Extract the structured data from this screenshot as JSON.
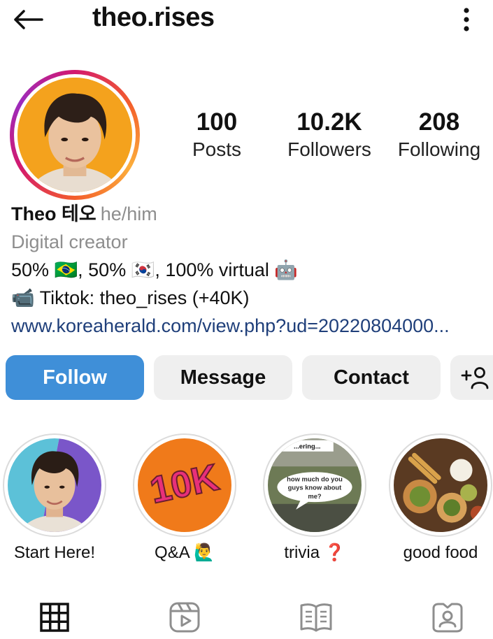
{
  "header": {
    "username": "theo.rises",
    "back_icon": "arrow-left-icon",
    "more_icon": "more-vertical-icon"
  },
  "profile": {
    "stats": [
      {
        "value": "100",
        "label": "Posts"
      },
      {
        "value": "10.2K",
        "label": "Followers"
      },
      {
        "value": "208",
        "label": "Following"
      }
    ]
  },
  "bio": {
    "name": "Theo 테오",
    "pronouns": "he/him",
    "category": "Digital creator",
    "line1": "50% 🇧🇷, 50% 🇰🇷, 100% virtual 🤖",
    "line2": "📹 Tiktok: theo_rises (+40K)",
    "link": "www.koreaherald.com/view.php?ud=20220804000..."
  },
  "actions": {
    "follow": "Follow",
    "message": "Message",
    "contact": "Contact",
    "add_user": "+👤"
  },
  "highlights": [
    {
      "label": "Start Here!"
    },
    {
      "label": "Q&A 🙋‍♂️",
      "cover_text": "10K"
    },
    {
      "label": "trivia ❓",
      "cover_text_top": "...ering...",
      "cover_text": "how much do you guys know about me?"
    },
    {
      "label": "good food"
    }
  ],
  "tabs": [
    {
      "icon": "grid-icon",
      "active": true
    },
    {
      "icon": "reels-icon",
      "active": false
    },
    {
      "icon": "guides-icon",
      "active": false
    },
    {
      "icon": "tagged-icon",
      "active": false
    }
  ],
  "colors": {
    "follow_button": "#3f8fd8",
    "secondary_button": "#efefef",
    "link": "#1f3f7a",
    "muted_text": "#8e8e8e"
  }
}
